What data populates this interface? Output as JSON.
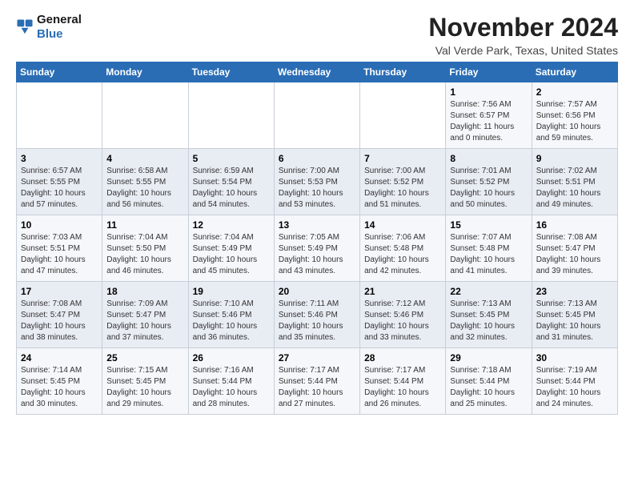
{
  "header": {
    "logo_line1": "General",
    "logo_line2": "Blue",
    "month": "November 2024",
    "location": "Val Verde Park, Texas, United States"
  },
  "days_of_week": [
    "Sunday",
    "Monday",
    "Tuesday",
    "Wednesday",
    "Thursday",
    "Friday",
    "Saturday"
  ],
  "rows": [
    [
      {
        "num": "",
        "info": ""
      },
      {
        "num": "",
        "info": ""
      },
      {
        "num": "",
        "info": ""
      },
      {
        "num": "",
        "info": ""
      },
      {
        "num": "",
        "info": ""
      },
      {
        "num": "1",
        "info": "Sunrise: 7:56 AM\nSunset: 6:57 PM\nDaylight: 11 hours and 0 minutes."
      },
      {
        "num": "2",
        "info": "Sunrise: 7:57 AM\nSunset: 6:56 PM\nDaylight: 10 hours and 59 minutes."
      }
    ],
    [
      {
        "num": "3",
        "info": "Sunrise: 6:57 AM\nSunset: 5:55 PM\nDaylight: 10 hours and 57 minutes."
      },
      {
        "num": "4",
        "info": "Sunrise: 6:58 AM\nSunset: 5:55 PM\nDaylight: 10 hours and 56 minutes."
      },
      {
        "num": "5",
        "info": "Sunrise: 6:59 AM\nSunset: 5:54 PM\nDaylight: 10 hours and 54 minutes."
      },
      {
        "num": "6",
        "info": "Sunrise: 7:00 AM\nSunset: 5:53 PM\nDaylight: 10 hours and 53 minutes."
      },
      {
        "num": "7",
        "info": "Sunrise: 7:00 AM\nSunset: 5:52 PM\nDaylight: 10 hours and 51 minutes."
      },
      {
        "num": "8",
        "info": "Sunrise: 7:01 AM\nSunset: 5:52 PM\nDaylight: 10 hours and 50 minutes."
      },
      {
        "num": "9",
        "info": "Sunrise: 7:02 AM\nSunset: 5:51 PM\nDaylight: 10 hours and 49 minutes."
      }
    ],
    [
      {
        "num": "10",
        "info": "Sunrise: 7:03 AM\nSunset: 5:51 PM\nDaylight: 10 hours and 47 minutes."
      },
      {
        "num": "11",
        "info": "Sunrise: 7:04 AM\nSunset: 5:50 PM\nDaylight: 10 hours and 46 minutes."
      },
      {
        "num": "12",
        "info": "Sunrise: 7:04 AM\nSunset: 5:49 PM\nDaylight: 10 hours and 45 minutes."
      },
      {
        "num": "13",
        "info": "Sunrise: 7:05 AM\nSunset: 5:49 PM\nDaylight: 10 hours and 43 minutes."
      },
      {
        "num": "14",
        "info": "Sunrise: 7:06 AM\nSunset: 5:48 PM\nDaylight: 10 hours and 42 minutes."
      },
      {
        "num": "15",
        "info": "Sunrise: 7:07 AM\nSunset: 5:48 PM\nDaylight: 10 hours and 41 minutes."
      },
      {
        "num": "16",
        "info": "Sunrise: 7:08 AM\nSunset: 5:47 PM\nDaylight: 10 hours and 39 minutes."
      }
    ],
    [
      {
        "num": "17",
        "info": "Sunrise: 7:08 AM\nSunset: 5:47 PM\nDaylight: 10 hours and 38 minutes."
      },
      {
        "num": "18",
        "info": "Sunrise: 7:09 AM\nSunset: 5:47 PM\nDaylight: 10 hours and 37 minutes."
      },
      {
        "num": "19",
        "info": "Sunrise: 7:10 AM\nSunset: 5:46 PM\nDaylight: 10 hours and 36 minutes."
      },
      {
        "num": "20",
        "info": "Sunrise: 7:11 AM\nSunset: 5:46 PM\nDaylight: 10 hours and 35 minutes."
      },
      {
        "num": "21",
        "info": "Sunrise: 7:12 AM\nSunset: 5:46 PM\nDaylight: 10 hours and 33 minutes."
      },
      {
        "num": "22",
        "info": "Sunrise: 7:13 AM\nSunset: 5:45 PM\nDaylight: 10 hours and 32 minutes."
      },
      {
        "num": "23",
        "info": "Sunrise: 7:13 AM\nSunset: 5:45 PM\nDaylight: 10 hours and 31 minutes."
      }
    ],
    [
      {
        "num": "24",
        "info": "Sunrise: 7:14 AM\nSunset: 5:45 PM\nDaylight: 10 hours and 30 minutes."
      },
      {
        "num": "25",
        "info": "Sunrise: 7:15 AM\nSunset: 5:45 PM\nDaylight: 10 hours and 29 minutes."
      },
      {
        "num": "26",
        "info": "Sunrise: 7:16 AM\nSunset: 5:44 PM\nDaylight: 10 hours and 28 minutes."
      },
      {
        "num": "27",
        "info": "Sunrise: 7:17 AM\nSunset: 5:44 PM\nDaylight: 10 hours and 27 minutes."
      },
      {
        "num": "28",
        "info": "Sunrise: 7:17 AM\nSunset: 5:44 PM\nDaylight: 10 hours and 26 minutes."
      },
      {
        "num": "29",
        "info": "Sunrise: 7:18 AM\nSunset: 5:44 PM\nDaylight: 10 hours and 25 minutes."
      },
      {
        "num": "30",
        "info": "Sunrise: 7:19 AM\nSunset: 5:44 PM\nDaylight: 10 hours and 24 minutes."
      }
    ]
  ]
}
